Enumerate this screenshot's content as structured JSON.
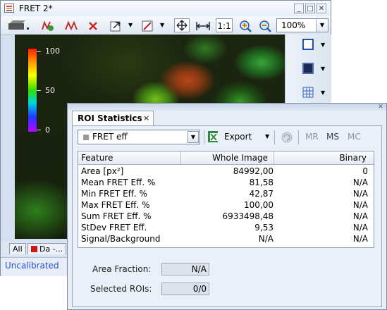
{
  "image_window": {
    "title": "FRET 2*",
    "window_buttons": [
      "minimize-icon",
      "maximize-icon",
      "close-icon"
    ],
    "toolbar": {
      "one_to_one": "1:1",
      "zoom_value": "100%"
    },
    "scale_bar": {
      "max_label": "100",
      "mid_label": "50",
      "min_label": "0",
      "colors": [
        "#ff1a00",
        "#ff9000",
        "#ffff00",
        "#33dd00",
        "#00d8d8",
        "#1f3bff",
        "#c000ff"
      ]
    },
    "bottom_tabs": [
      "All",
      "Da -..."
    ],
    "status": "Uncalibrated"
  },
  "roi_panel": {
    "tab_label": "ROI Statistics",
    "tab_close": "×",
    "feature_select": {
      "value": "FRET eff"
    },
    "export_label": "Export",
    "buttons": {
      "mr": "MR",
      "ms": "MS",
      "mc": "MC"
    },
    "table": {
      "columns": [
        "Feature",
        "Whole Image",
        "Binary"
      ],
      "rows": [
        {
          "feature": "Area [px²]",
          "whole": "84992,00",
          "binary": "0"
        },
        {
          "feature": "Mean FRET Eff. %",
          "whole": "81,58",
          "binary": "N/A"
        },
        {
          "feature": "Min FRET Eff. %",
          "whole": "42,87",
          "binary": "N/A"
        },
        {
          "feature": "Max FRET Eff. %",
          "whole": "100,00",
          "binary": "N/A"
        },
        {
          "feature": "Sum FRET Eff. %",
          "whole": "6933498,48",
          "binary": "N/A"
        },
        {
          "feature": "StDev FRET Eff.",
          "whole": "9,53",
          "binary": "N/A"
        },
        {
          "feature": "Signal/Background",
          "whole": "N/A",
          "binary": "N/A"
        }
      ]
    },
    "area_fraction": {
      "label": "Area Fraction:",
      "value": "N/A"
    },
    "selected_rois": {
      "label": "Selected ROIs:",
      "value": "0/0"
    }
  }
}
